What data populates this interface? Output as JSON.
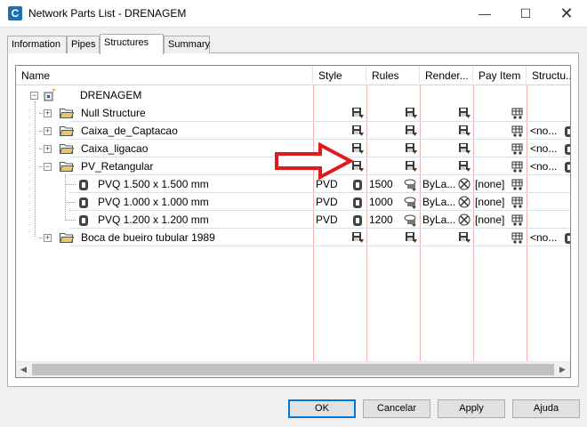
{
  "window": {
    "title": "Network Parts List - DRENAGEM",
    "app_icon_letter": "C",
    "minimize_glyph": "—",
    "maximize_glyph": "☐",
    "close_glyph": "✕"
  },
  "tabs": [
    {
      "label": "Information",
      "active": false
    },
    {
      "label": "Pipes",
      "active": false
    },
    {
      "label": "Structures",
      "active": true
    },
    {
      "label": "Summary",
      "active": false
    }
  ],
  "columns": [
    "Name",
    "Style",
    "Rules",
    "Render...",
    "Pay Item",
    "Structu..."
  ],
  "tree": {
    "root": {
      "name": "DRENAGEM",
      "expander": "−"
    },
    "rows": [
      {
        "name": "Null Structure",
        "level": 1,
        "expander": "+",
        "style": "",
        "rules": "",
        "render": "",
        "payitem": "",
        "structure": "",
        "has_structure_icon": false
      },
      {
        "name": "Caixa_de_Captacao",
        "level": 1,
        "expander": "+",
        "style": "",
        "rules": "",
        "render": "",
        "payitem": "",
        "structure": "<no...",
        "has_structure_icon": true
      },
      {
        "name": "Caixa_ligacao",
        "level": 1,
        "expander": "+",
        "style": "",
        "rules": "",
        "render": "",
        "payitem": "",
        "structure": "<no...",
        "has_structure_icon": true
      },
      {
        "name": "PV_Retangular",
        "level": 1,
        "expander": "−",
        "style": "",
        "rules": "",
        "render": "",
        "payitem": "",
        "structure": "<no...",
        "has_structure_icon": true
      },
      {
        "name": "PVQ 1.500 x 1.500 mm",
        "level": 2,
        "expander": "",
        "style": "PVD",
        "rules": "1500",
        "render": "ByLa...",
        "payitem": "[none]",
        "structure": "",
        "has_structure_icon": false
      },
      {
        "name": "PVQ 1.000 x 1.000 mm",
        "level": 2,
        "expander": "",
        "style": "PVD",
        "rules": "1000",
        "render": "ByLa...",
        "payitem": "[none]",
        "structure": "",
        "has_structure_icon": false
      },
      {
        "name": "PVQ 1.200 x 1.200 mm",
        "level": 2,
        "expander": "",
        "style": "PVD",
        "rules": "1200",
        "render": "ByLa...",
        "payitem": "[none]",
        "structure": "",
        "has_structure_icon": false
      },
      {
        "name": "Boca de bueiro tubular 1989",
        "level": 1,
        "expander": "+",
        "style": "",
        "rules": "",
        "render": "",
        "payitem": "",
        "structure": "<no...",
        "has_structure_icon": true
      }
    ]
  },
  "scroll": {
    "left_glyph": "◀",
    "right_glyph": "▶"
  },
  "buttons": {
    "ok": "OK",
    "cancel": "Cancelar",
    "apply": "Apply",
    "help": "Ajuda"
  },
  "colors": {
    "accent": "#0078d7",
    "annotation_arrow": "#e11b1b",
    "grid_vline": "#f2b3b3",
    "folder": "#e8c66a"
  }
}
